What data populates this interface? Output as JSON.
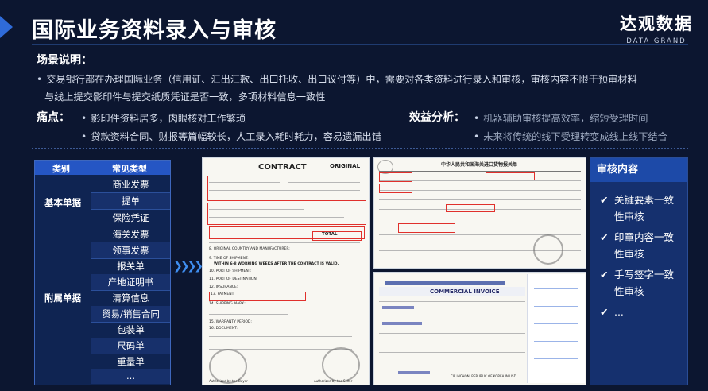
{
  "header": {
    "title": "国际业务资料录入与审核",
    "brand_cn": "达观数据",
    "brand_en": "DATA GRAND"
  },
  "scenario": {
    "heading": "场景说明：",
    "line1": "交易银行部在办理国际业务（信用证、汇出汇款、出口托收、出口议付等）中，需要对各类资料进行录入和审核，审核内容不限于预审材料",
    "line2": "与线上提交影印件与提交纸质凭证是否一致，多项材料信息一致性"
  },
  "pain_points": {
    "heading": "痛点：",
    "items": [
      "影印件资料居多，肉眼核对工作繁琐",
      "贷款资料合同、财报等篇幅较长，人工录入耗时耗力，容易遗漏出错"
    ]
  },
  "benefits": {
    "heading": "效益分析：",
    "items": [
      "机器辅助审核提高效率，缩短受理时间",
      "未来将传统的线下受理转变成线上线下结合"
    ]
  },
  "categories": {
    "col_category": "类别",
    "col_types": "常见类型",
    "groups": [
      {
        "name": "基本单据",
        "items": [
          "商业发票",
          "提单",
          "保险凭证"
        ]
      },
      {
        "name": "附属单据",
        "items": [
          "海关发票",
          "领事发票",
          "报关单",
          "产地证明书",
          "清算信息",
          "贸易/销售合同",
          "包装单",
          "尺码单",
          "重量单",
          "..."
        ]
      }
    ]
  },
  "doc_contract": {
    "title": "CONTRACT",
    "badge": "ORIGINAL",
    "total_label": "TOTAL",
    "clause_8": "8. ORIGINAL COUNTRY AND MANUFACTURER:",
    "clause_9": "9. TIME OF SHIPMENT:",
    "shipment_text": "WITHIN 6-8 WORKING WEEKS AFTER THE CONTRACT IS VALID.",
    "clause_10": "10. PORT OF SHIPMENT:",
    "clause_11": "11. PORT OF DESTINATION:",
    "clause_12": "12. INSURANCE:",
    "clause_13": "13. PAYMENT:",
    "clause_14": "14. SHIPPING MARK:",
    "clause_15": "15. WARRANTY PERIOD:",
    "clause_16": "16. DOCUMENT:",
    "authorized_buyer": "Authorized by the Buyer",
    "authorized_seller": "Authorized by the Seller"
  },
  "doc_customs": {
    "title": "中华人民共和国海关进口货物报关单"
  },
  "doc_invoice": {
    "title": "COMMERCIAL INVOICE",
    "destination": "CIF INCHON, REPUBLIC OF KOREA IN USD"
  },
  "review": {
    "title": "审核内容",
    "check_icon": "✔",
    "items": [
      "关键要素一致性审核",
      "印章内容一致性审核",
      "手写签字一致性审核",
      "..."
    ]
  }
}
